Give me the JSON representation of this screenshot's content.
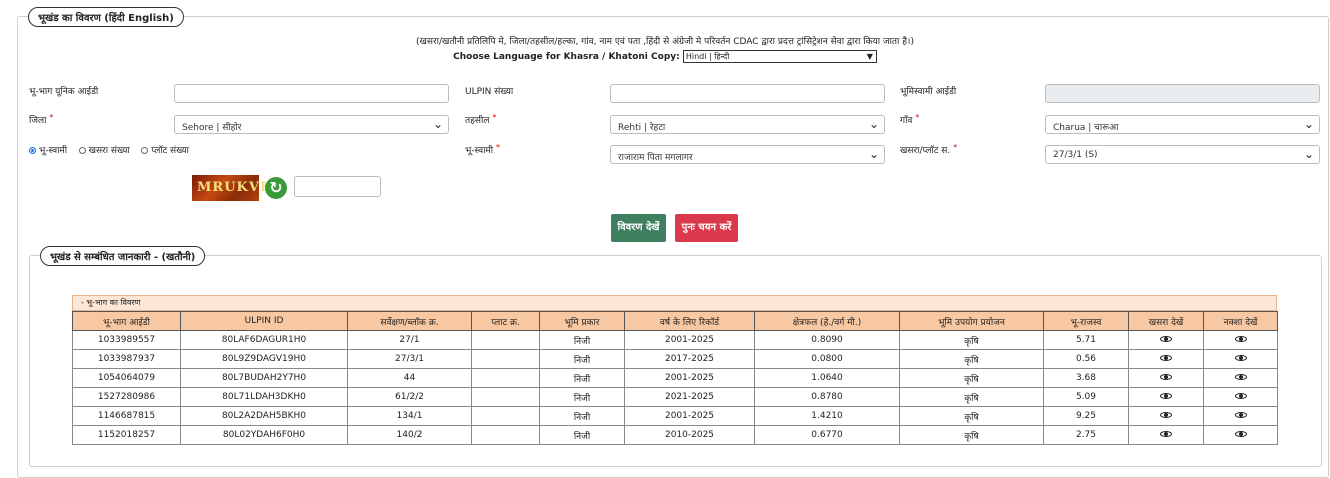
{
  "section1": {
    "title": "भूखंड का विवरण  (हिंदी  English)",
    "notice": "(खसरा/खतौनी प्रतिलिपि मे, जिला/तहसील/हल्का, गांव, नाम एवं पता ,हिंदी से अंग्रेजी मे परिवर्तन CDAC द्वारा प्रदत्त ट्रांसिट्रेशन सेवा द्वारा किया जाता है।)",
    "language_label": "Choose Language for Khasra / Khatoni Copy:",
    "language_value": "Hindi | हिन्दी"
  },
  "form": {
    "bhubhag_id_label": "भू-भाग यूनिक आईडी",
    "ulpin_label": "ULPIN संख्या",
    "bhoomiswami_id_label": "भूमिस्वामी आईडी",
    "district_label": "जिला",
    "district_value": "Sehore | सीहोर",
    "tehsil_label": "तहसील",
    "tehsil_value": "Rehti | रेहटा",
    "village_label": "गाँव",
    "village_value": "Charua | चारूआ",
    "owner_label": "भू-स्वामी",
    "owner_value": "राजाराम पिता मगलागर",
    "khasra_plot_label": "खसरा/प्लॉट स.",
    "khasra_plot_value": "27/3/1 (S)",
    "radio_owner": "भू-स्वामी",
    "radio_khasra": "खसरा संख्या",
    "radio_plot": "प्लॉट संख्या",
    "required_mark": "*"
  },
  "captcha": {
    "text": "MRUKVK",
    "refresh_icon": "↻"
  },
  "buttons": {
    "view": "विवरण देखें",
    "reselect": "पुनः चयन करें"
  },
  "section2": {
    "title": "भूखंड से सम्बंधित जानकारी -   (खतौनी)",
    "table_caption": "- भू-भाग का विवरण",
    "headers": [
      "भू-भाग आईडी",
      "ULPIN ID",
      "सर्वेक्षण/ब्लॉक क्र.",
      "प्लाट क्र.",
      "भूमि प्रकार",
      "वर्ष के लिए रिकॉर्ड",
      "क्षेत्रफल (हे./वर्ग मी.)",
      "भूमि उपयोग प्रयोजन",
      "भू-राजस्व",
      "खसरा देखें",
      "नक्शा देखें"
    ],
    "rows": [
      [
        "1033989557",
        "80LAF6DAGUR1H0",
        "27/1",
        "",
        "निजी",
        "2001-2025",
        "0.8090",
        "कृषि",
        "5.71"
      ],
      [
        "1033987937",
        "80L9Z9DAGV19H0",
        "27/3/1",
        "",
        "निजी",
        "2017-2025",
        "0.0800",
        "कृषि",
        "0.56"
      ],
      [
        "1054064079",
        "80L7BUDAH2Y7H0",
        "44",
        "",
        "निजी",
        "2001-2025",
        "1.0640",
        "कृषि",
        "3.68"
      ],
      [
        "1527280986",
        "80L71LDAH3DKH0",
        "61/2/2",
        "",
        "निजी",
        "2021-2025",
        "0.8780",
        "कृषि",
        "5.09"
      ],
      [
        "1146687815",
        "80L2A2DAH5BKH0",
        "134/1",
        "",
        "निजी",
        "2001-2025",
        "1.4210",
        "कृषि",
        "9.25"
      ],
      [
        "1152018257",
        "80L02YDAH6F0H0",
        "140/2",
        "",
        "निजी",
        "2010-2025",
        "0.6770",
        "कृषि",
        "2.75"
      ]
    ]
  }
}
